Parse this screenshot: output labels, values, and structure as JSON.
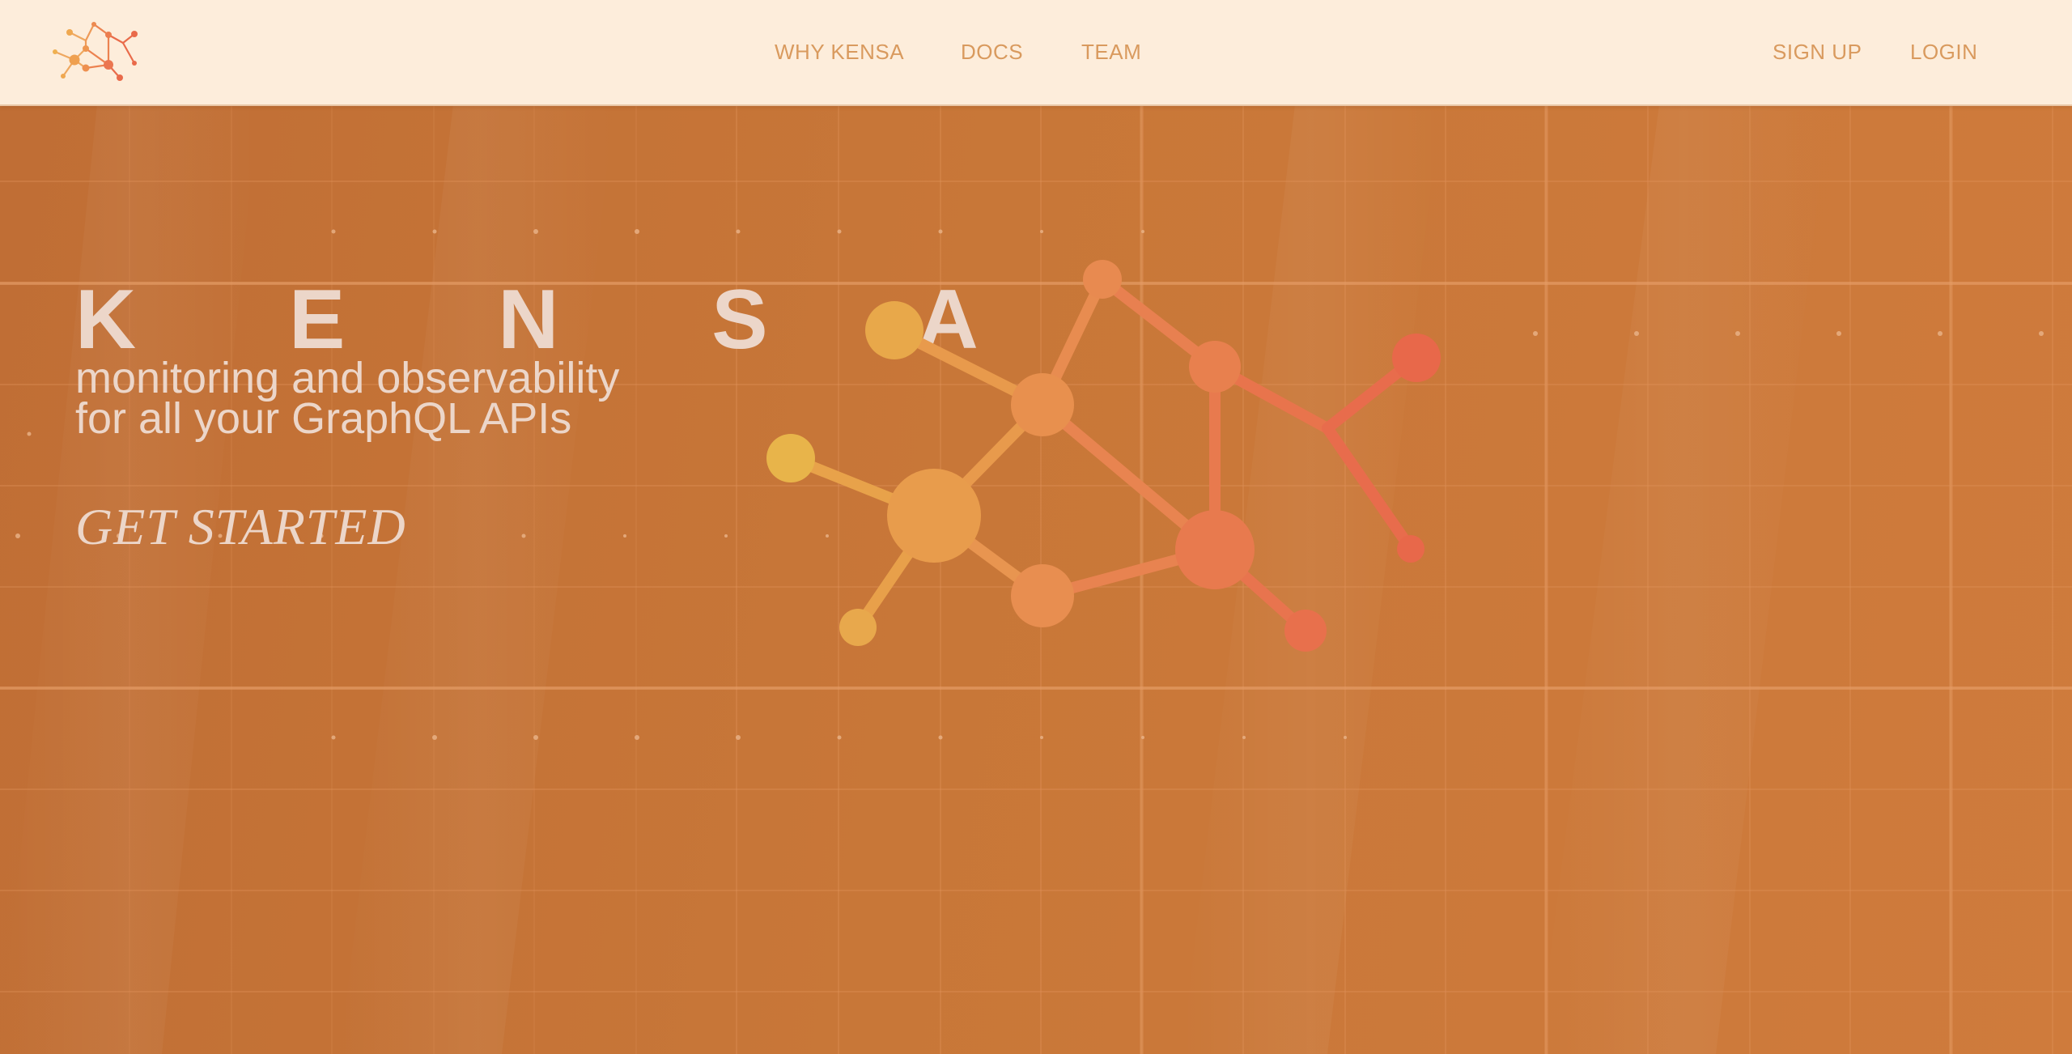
{
  "nav": {
    "logo_icon": "molecule-network-icon",
    "links": [
      {
        "label": "WHY KENSA"
      },
      {
        "label": "DOCS"
      },
      {
        "label": "TEAM"
      }
    ],
    "auth": {
      "signup_label": "SIGN UP",
      "login_label": "LOGIN"
    }
  },
  "hero": {
    "title": "K E N S A",
    "tagline_line1": "monitoring and observability",
    "tagline_line2": "for all your GraphQL APIs",
    "cta_label": "GET STARTED",
    "illustration_icon": "graph-molecule-icon"
  },
  "colors": {
    "nav_background": "#fdeddb",
    "nav_link": "#d99a5e",
    "hero_background": "#c47336",
    "hero_text": "#ecd6c9",
    "node_yellow": "#e8b04a",
    "node_orange": "#e88f4a",
    "node_red": "#e86a4a"
  }
}
